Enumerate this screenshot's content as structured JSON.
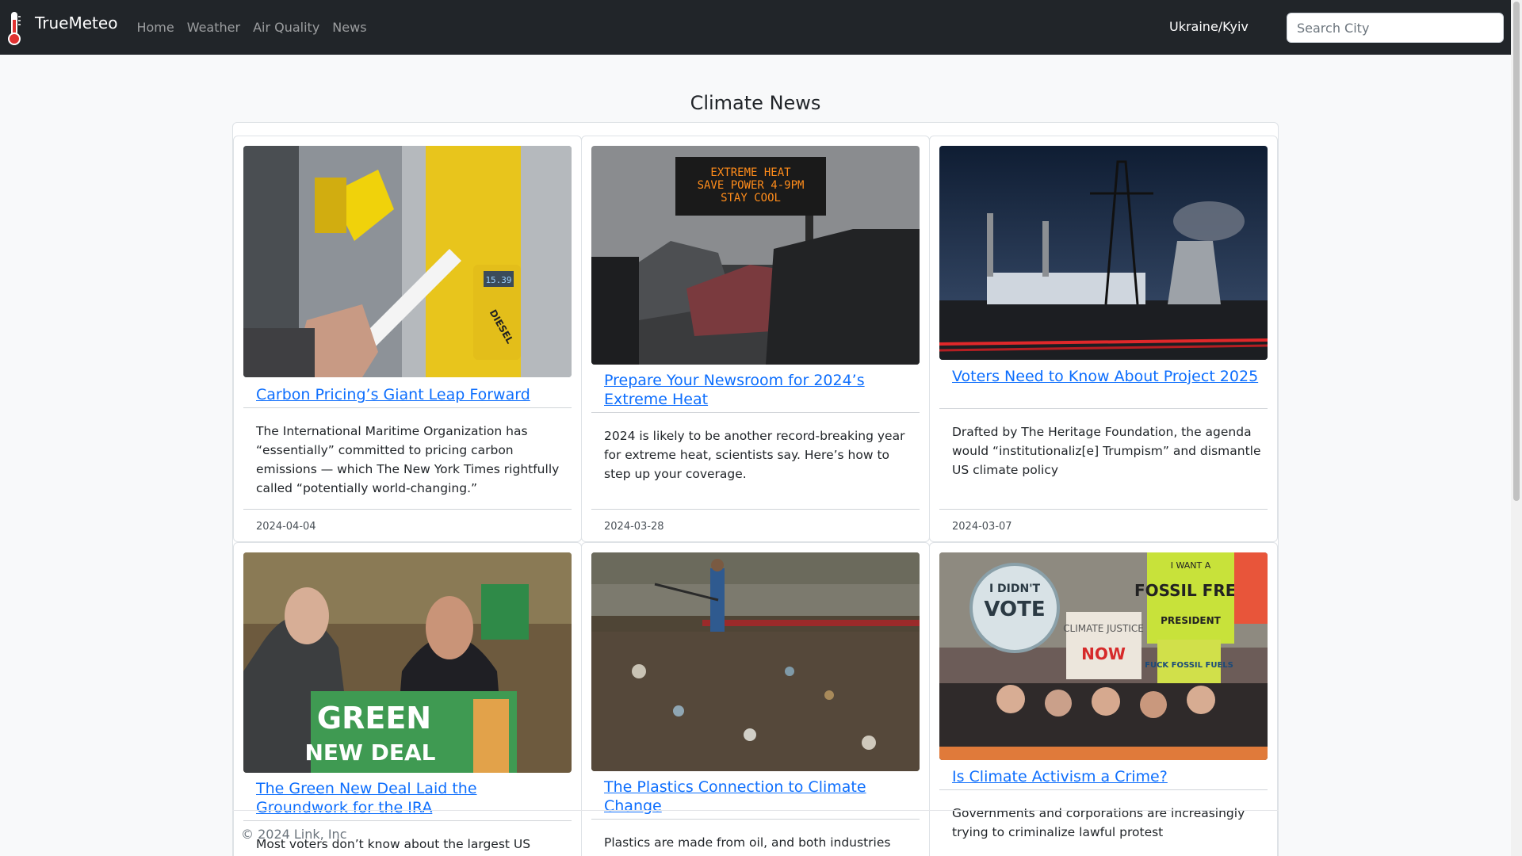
{
  "navbar": {
    "brand": "TrueMeteo",
    "links": [
      "Home",
      "Weather",
      "Air Quality",
      "News"
    ],
    "location": "Ukraine/Kyiv",
    "search_placeholder": "Search City"
  },
  "page": {
    "title": "Climate News"
  },
  "articles": [
    {
      "title": "Carbon Pricing’s Giant Leap Forward",
      "summary": "The International Maritime Organization has “essentially” committed to pricing carbon emissions — which The New York Times rightfully called “potentially world-changing.”",
      "date": "2024-04-04",
      "image_texts": [
        "DIESEL",
        "15.39"
      ]
    },
    {
      "title": "Prepare Your Newsroom for 2024’s Extreme Heat",
      "summary": "2024 is likely to be another record-breaking year for extreme heat, scientists say. Here’s how to step up your coverage.",
      "date": "2024-03-28",
      "image_texts": [
        "EXTREME HEAT",
        "SAVE POWER 4-9PM",
        "STAY COOL"
      ]
    },
    {
      "title": "Voters Need to Know About Project 2025",
      "summary": "Drafted by The Heritage Foundation, the agenda would “institutionaliz[e] Trumpism” and dismantle US climate policy",
      "date": "2024-03-07",
      "image_texts": []
    },
    {
      "title": "The Green New Deal Laid the Groundwork for the IRA",
      "summary": "Most voters don’t know about the largest US",
      "date": "",
      "image_texts": [
        "GREEN",
        "NEW DEAL"
      ]
    },
    {
      "title": "The Plastics Connection to Climate Change",
      "summary": "Plastics are made from oil, and both industries have",
      "date": "",
      "image_texts": []
    },
    {
      "title": "Is Climate Activism a Crime?",
      "summary": "Governments and corporations are increasingly trying to criminalize lawful protest",
      "date": "",
      "image_texts": [
        "I DIDN'T",
        "VOTE",
        "CLIMATE JUSTICE",
        "NOW",
        "I WANT A",
        "FOSSIL FREE",
        "PRESIDENT",
        "FUCK FOSSIL FUELS"
      ]
    }
  ],
  "footer": {
    "text": "© 2024 Link, Inc"
  },
  "colors": {
    "navbar": "#212529",
    "link": "#0d6efd",
    "background": "#f8f9fa"
  }
}
